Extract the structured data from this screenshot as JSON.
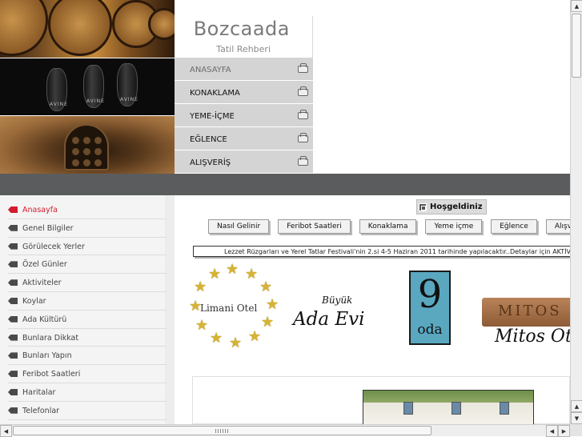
{
  "header": {
    "title": "Bozcaada",
    "subtitle": "Tatil Rehberi",
    "glass_label": "AVINE"
  },
  "top_menu": {
    "items": [
      {
        "label": "ANASAYFA",
        "active": true
      },
      {
        "label": "KONAKLAMA"
      },
      {
        "label": "YEME-İÇME"
      },
      {
        "label": "EĞLENCE"
      },
      {
        "label": "ALIŞVERİŞ"
      }
    ]
  },
  "left_nav": {
    "items": [
      {
        "label": "Anasayfa",
        "active": true
      },
      {
        "label": "Genel Bilgiler"
      },
      {
        "label": "Görülecek Yerler"
      },
      {
        "label": "Özel Günler"
      },
      {
        "label": "Aktiviteler"
      },
      {
        "label": "Koylar"
      },
      {
        "label": "Ada Kültürü"
      },
      {
        "label": "Bunlara Dikkat"
      },
      {
        "label": "Bunları Yapın"
      },
      {
        "label": "Feribot Saatleri"
      },
      {
        "label": "Haritalar"
      },
      {
        "label": "Telefonlar"
      }
    ]
  },
  "main": {
    "welcome": "Hoşgeldiniz",
    "tabs": [
      {
        "label": "Nasıl Gelinir"
      },
      {
        "label": "Feribot Saatleri"
      },
      {
        "label": "Konaklama"
      },
      {
        "label": "Yeme içme"
      },
      {
        "label": "Eğlence"
      },
      {
        "label": "Alışv"
      }
    ],
    "marquee": "Lezzet Rüzgarları ve Yerel Tatlar Festivali'nin 2.si 4-5 Haziran 2011 tarihinde yapılacaktır..Detaylar için AKTİVİTE"
  },
  "logos": {
    "limani": "Limani Otel",
    "adaevi_top": "Büyük",
    "adaevi_main": "Ada Evi",
    "oda_number": "9",
    "oda_word": "oda",
    "mitos_band": "MITOS",
    "mitos_name": "Mitos Otel"
  },
  "scrollbars": {
    "up": "▲",
    "down": "▼",
    "left": "◀",
    "right": "▶"
  },
  "colors": {
    "accent_red": "#d21c2c",
    "menu_grey": "#d4d4d4",
    "dark_band": "#5a5c5d"
  }
}
